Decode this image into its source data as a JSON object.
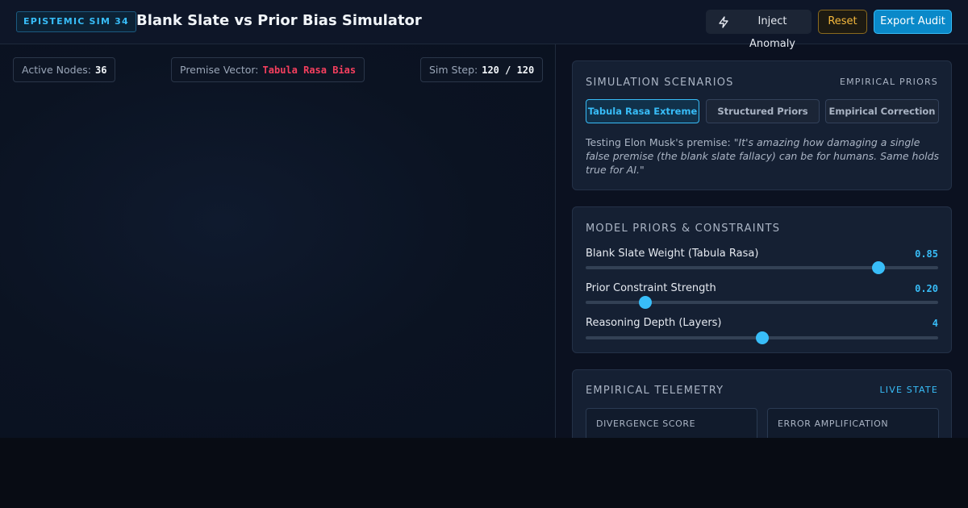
{
  "header": {
    "badge": "EPISTEMIC SIM 34",
    "title": "Blank Slate vs Prior Bias Simulator",
    "inject_label": "Inject Anomaly",
    "reset_label": "Reset",
    "export_label": "Export Audit"
  },
  "canvas": {
    "active_nodes_label": "Active Nodes:",
    "active_nodes_value": "36",
    "premise_label": "Premise Vector:",
    "premise_value": "Tabula Rasa Bias",
    "sim_step_label": "Sim Step:",
    "sim_step_value": "120 / 120"
  },
  "scenarios": {
    "title": "SIMULATION SCENARIOS",
    "tag": "EMPIRICAL PRIORS",
    "buttons": [
      "Tabula Rasa Extreme",
      "Structured Priors",
      "Empirical Correction"
    ],
    "active_index": 0,
    "quote_prefix": "Testing Elon Musk's premise: \"",
    "quote_text": "It's amazing how damaging a single false premise (the blank slate fallacy) can be for humans. Same holds true for AI.",
    "quote_suffix": "\""
  },
  "priors": {
    "title": "MODEL PRIORS & CONSTRAINTS",
    "sliders": [
      {
        "label": "Blank Slate Weight (Tabula Rasa)",
        "value": "0.85",
        "fraction": 0.83
      },
      {
        "label": "Prior Constraint Strength",
        "value": "0.20",
        "fraction": 0.17
      },
      {
        "label": "Reasoning Depth (Layers)",
        "value": "4",
        "fraction": 0.5
      }
    ]
  },
  "telemetry": {
    "title": "EMPIRICAL TELEMETRY",
    "tag": "LIVE STATE",
    "metrics": [
      "DIVERGENCE SCORE",
      "ERROR AMPLIFICATION"
    ]
  },
  "colors": {
    "accent": "#38bdf8",
    "warning": "#f5b83d",
    "danger": "#f43f5e"
  },
  "icons": {
    "inject": "lightning-icon"
  }
}
